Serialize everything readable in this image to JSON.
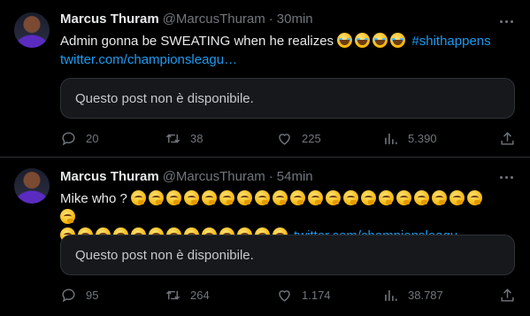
{
  "tweets": [
    {
      "name": "Marcus Thuram",
      "handle": "@MarcusThuram",
      "separator": "·",
      "time": "30min",
      "text": "Admin gonna be SWEATING when he realizes",
      "emoji_laugh_count": 4,
      "hashtag": "#shithappens",
      "link": "twitter.com/championsleagu…",
      "card_text": "Questo post non è disponibile.",
      "replies": "20",
      "retweets": "38",
      "likes": "225",
      "views": "5.390"
    },
    {
      "name": "Marcus Thuram",
      "handle": "@MarcusThuram",
      "separator": "·",
      "time": "54min",
      "text": "Mike who ?",
      "emoji_think_line1": 21,
      "emoji_think_line2": 13,
      "link": "twitter.com/championsleagu…",
      "card_text": "Questo post non è disponibile.",
      "replies": "95",
      "retweets": "264",
      "likes": "1.174",
      "views": "38.787"
    }
  ],
  "icons": {
    "reply": "reply-icon",
    "retweet": "retweet-icon",
    "like": "heart-icon",
    "views": "views-icon",
    "share": "share-icon",
    "more": "more-icon"
  },
  "colors": {
    "background": "#000000",
    "text": "#e7e9ea",
    "muted": "#71767b",
    "link": "#1d9bf0",
    "border": "#2f3336",
    "card": "#16181c"
  }
}
